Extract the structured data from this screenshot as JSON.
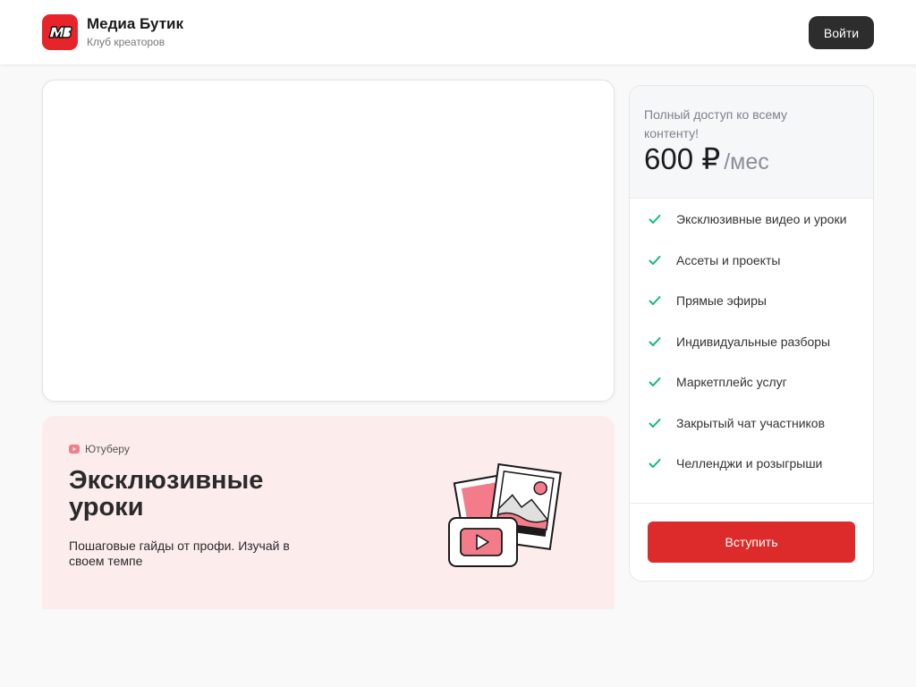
{
  "header": {
    "brand_title": "Медиа Бутик",
    "brand_subtitle": "Клуб креаторов",
    "login_label": "Войти",
    "logo_icon": "mb-logo-icon"
  },
  "feature": {
    "tag": "Ютуберу",
    "tag_icon": "youtube-icon",
    "title": "Эксклюзивные уроки",
    "description": "Пошаговые гайды от профи. Изучай в своем темпе",
    "illustration_icon": "photos-video-illustration"
  },
  "pricing": {
    "caption": "Полный доступ ко всему контенту!",
    "amount": "600 ₽",
    "period": "/мес",
    "benefits": [
      "Эксклюзивные видео и уроки",
      "Ассеты и проекты",
      "Прямые эфиры",
      "Индивидуальные разборы",
      "Маркетплейс услуг",
      "Закрытый чат участников",
      "Челленджи и розыгрыши"
    ],
    "join_label": "Вступить"
  },
  "colors": {
    "brand_red": "#e8242b",
    "accent_red": "#dd2a2a",
    "check_green": "#10b981",
    "feature_bg": "#fdecec",
    "dark_button": "#2d2d2d"
  }
}
